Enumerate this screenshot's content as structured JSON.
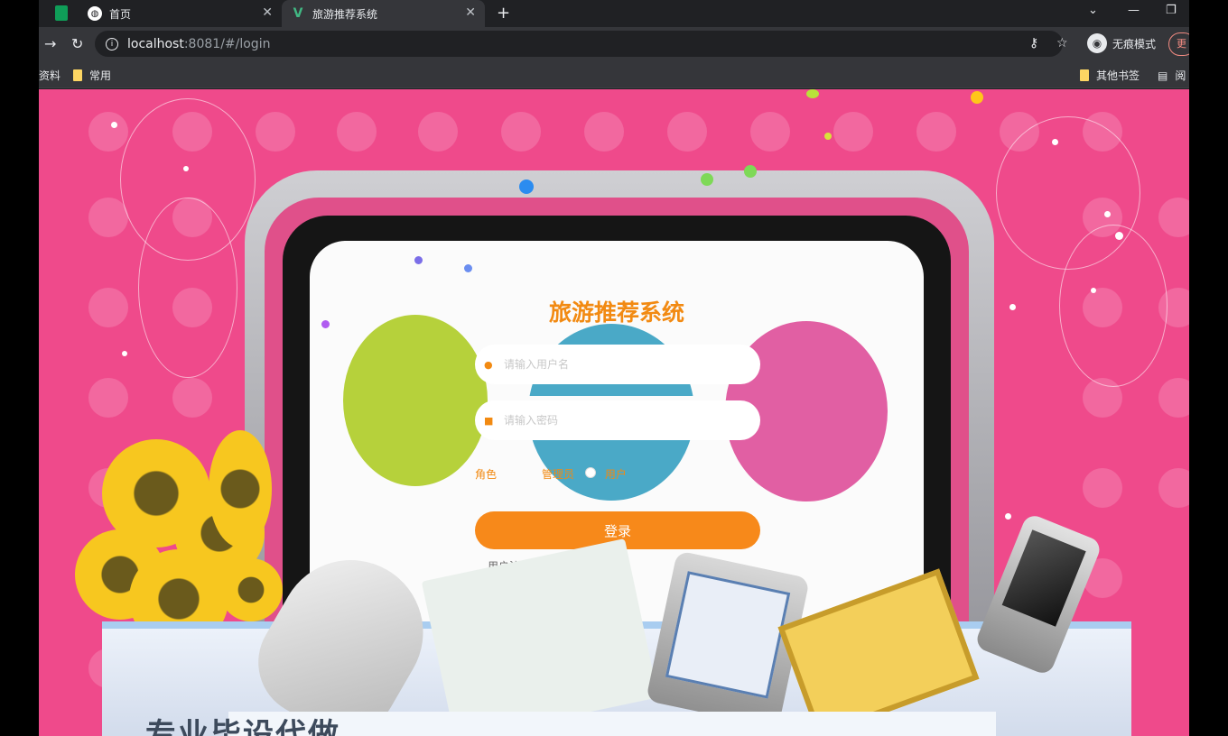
{
  "browser": {
    "tabs": [
      {
        "label": "首页",
        "active": false
      },
      {
        "label": "旅游推荐系统",
        "active": true
      }
    ],
    "address": {
      "host": "localhost",
      "rest": ":8081/#/login"
    },
    "incognito_label": "无痕模式",
    "bookmarks": {
      "left": [
        "资料",
        "常用"
      ],
      "right": [
        "其他书签",
        "阅"
      ]
    },
    "update_label": "更"
  },
  "login": {
    "title": "旅游推荐系统",
    "username_placeholder": "请输入用户名",
    "password_placeholder": "请输入密码",
    "role_label": "角色",
    "role_options": [
      "管理员",
      "用户"
    ],
    "login_button": "登录",
    "register_link": "用户注册"
  },
  "banner_text": "专业毕设代做",
  "colors": {
    "page_bg": "#ef4a8b",
    "accent": "#f7891a"
  }
}
